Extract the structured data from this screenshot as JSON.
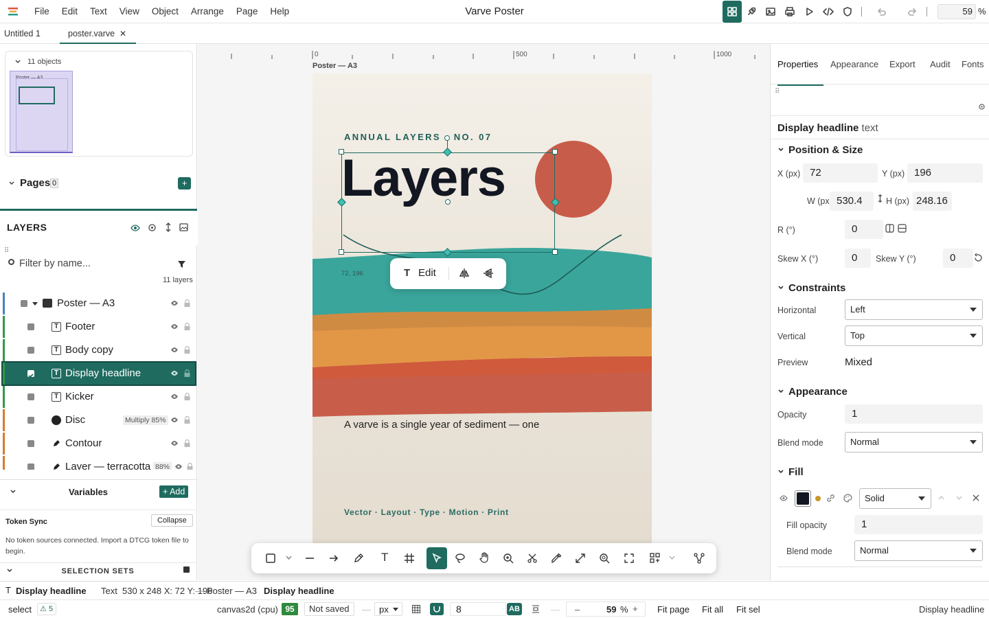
{
  "app": {
    "title": "Varve Poster"
  },
  "menu": [
    "File",
    "Edit",
    "Text",
    "View",
    "Object",
    "Arrange",
    "Page",
    "Help"
  ],
  "toolbar": {
    "zoom": "59",
    "zoom_unit": "%"
  },
  "doc_tabs": [
    {
      "label": "Untitled 1"
    },
    {
      "label": "poster.varve",
      "close": "✕"
    }
  ],
  "left": {
    "objects_label": "11 objects",
    "thumb_label": "Poster — A3",
    "pages_label": "Pages",
    "pages_count": "0",
    "pages_add": "+",
    "layers_title": "LAYERS",
    "filter_placeholder": "Filter by name...",
    "layers_count": "11 layers",
    "layers": [
      {
        "name": "Poster — A3",
        "icon": "frame",
        "color": "#4a7fc1"
      },
      {
        "name": "Footer",
        "icon": "T",
        "color": "#2f9a45"
      },
      {
        "name": "Body copy",
        "icon": "T",
        "color": "#2f9a45"
      },
      {
        "name": "Display headline",
        "icon": "T",
        "color": "#2f9a45",
        "selected": true
      },
      {
        "name": "Kicker",
        "icon": "T",
        "color": "#2f9a45"
      },
      {
        "name": "Disc",
        "icon": "circle",
        "color": "#d97a2a",
        "badge": "Multiply 85%"
      },
      {
        "name": "Contour",
        "icon": "pen",
        "color": "#d97a2a"
      },
      {
        "name": "Layer — terracotta",
        "icon": "pen",
        "color": "#d97a2a",
        "badge": "88%"
      }
    ],
    "variables_title": "Variables",
    "variables_add": "+ Add",
    "token_sync_title": "Token Sync",
    "token_sync_collapse": "Collapse",
    "token_sync_text": "No token sources connected. Import a DTCG token file to begin.",
    "selection_sets_title": "SELECTION SETS"
  },
  "canvas": {
    "ruler_labels": [
      "0",
      "500",
      "1000"
    ],
    "artboard_label": "Poster — A3",
    "kicker": "ANNUAL LAYERS · NO. 07",
    "headline": "Layers",
    "coords": "72, 196",
    "body": "A varve is a single year of sediment — one",
    "footer": "Vector · Layout · Type · Motion · Print",
    "edit_label": "Edit",
    "colors": {
      "teal": "#3aa59b",
      "ochre": "#d08b43",
      "orange": "#e29747",
      "red": "#cf5a3c",
      "terracotta": "#c85e4a",
      "disc": "#c85c4a",
      "ink": "#131722",
      "accent": "#1f6b60"
    }
  },
  "right": {
    "tabs": [
      "Properties",
      "Appearance",
      "Export",
      "Audit",
      "Fonts"
    ],
    "object_name": "Display headline",
    "object_type": "text",
    "sections": {
      "pos": "Position & Size",
      "constraints": "Constraints",
      "appearance": "Appearance",
      "fill": "Fill"
    },
    "x_label": "X (px)",
    "x": "72",
    "y_label": "Y (px)",
    "y": "196",
    "w_label": "W (px)",
    "w": "530.4",
    "h_label": "H (px)",
    "h": "248.16",
    "r_label": "R (°)",
    "r": "0",
    "skewx_label": "Skew X (°)",
    "skewx": "0",
    "skewy_label": "Skew Y (°)",
    "skewy": "0",
    "horizontal_label": "Horizontal",
    "horizontal": "Left",
    "vertical_label": "Vertical",
    "vertical": "Top",
    "preview_label": "Preview",
    "preview": "Mixed",
    "opacity_label": "Opacity",
    "opacity": "1",
    "blend_label": "Blend mode",
    "blend": "Normal",
    "fill_type": "Solid",
    "fill_color": "#131722",
    "fill_opacity_label": "Fill opacity",
    "fill_opacity": "1",
    "fill_blend_label": "Blend mode",
    "fill_blend": "Normal"
  },
  "status": {
    "type_label": "Display headline",
    "type_kind": "Text",
    "dims": "530 x 248 X: 72 Y: 196",
    "crumb1": "Poster — A3",
    "crumb2": "Display headline",
    "mode": "select",
    "warnings": "5",
    "renderer": "canvas2d (cpu)",
    "score": "95",
    "save_state": "Not saved",
    "unit": "px",
    "grid": "8",
    "ab": "AB",
    "zoom": "59",
    "zoom_unit": "%",
    "fit_page": "Fit page",
    "fit_all": "Fit all",
    "fit_sel": "Fit sel",
    "selection": "Display headline"
  }
}
